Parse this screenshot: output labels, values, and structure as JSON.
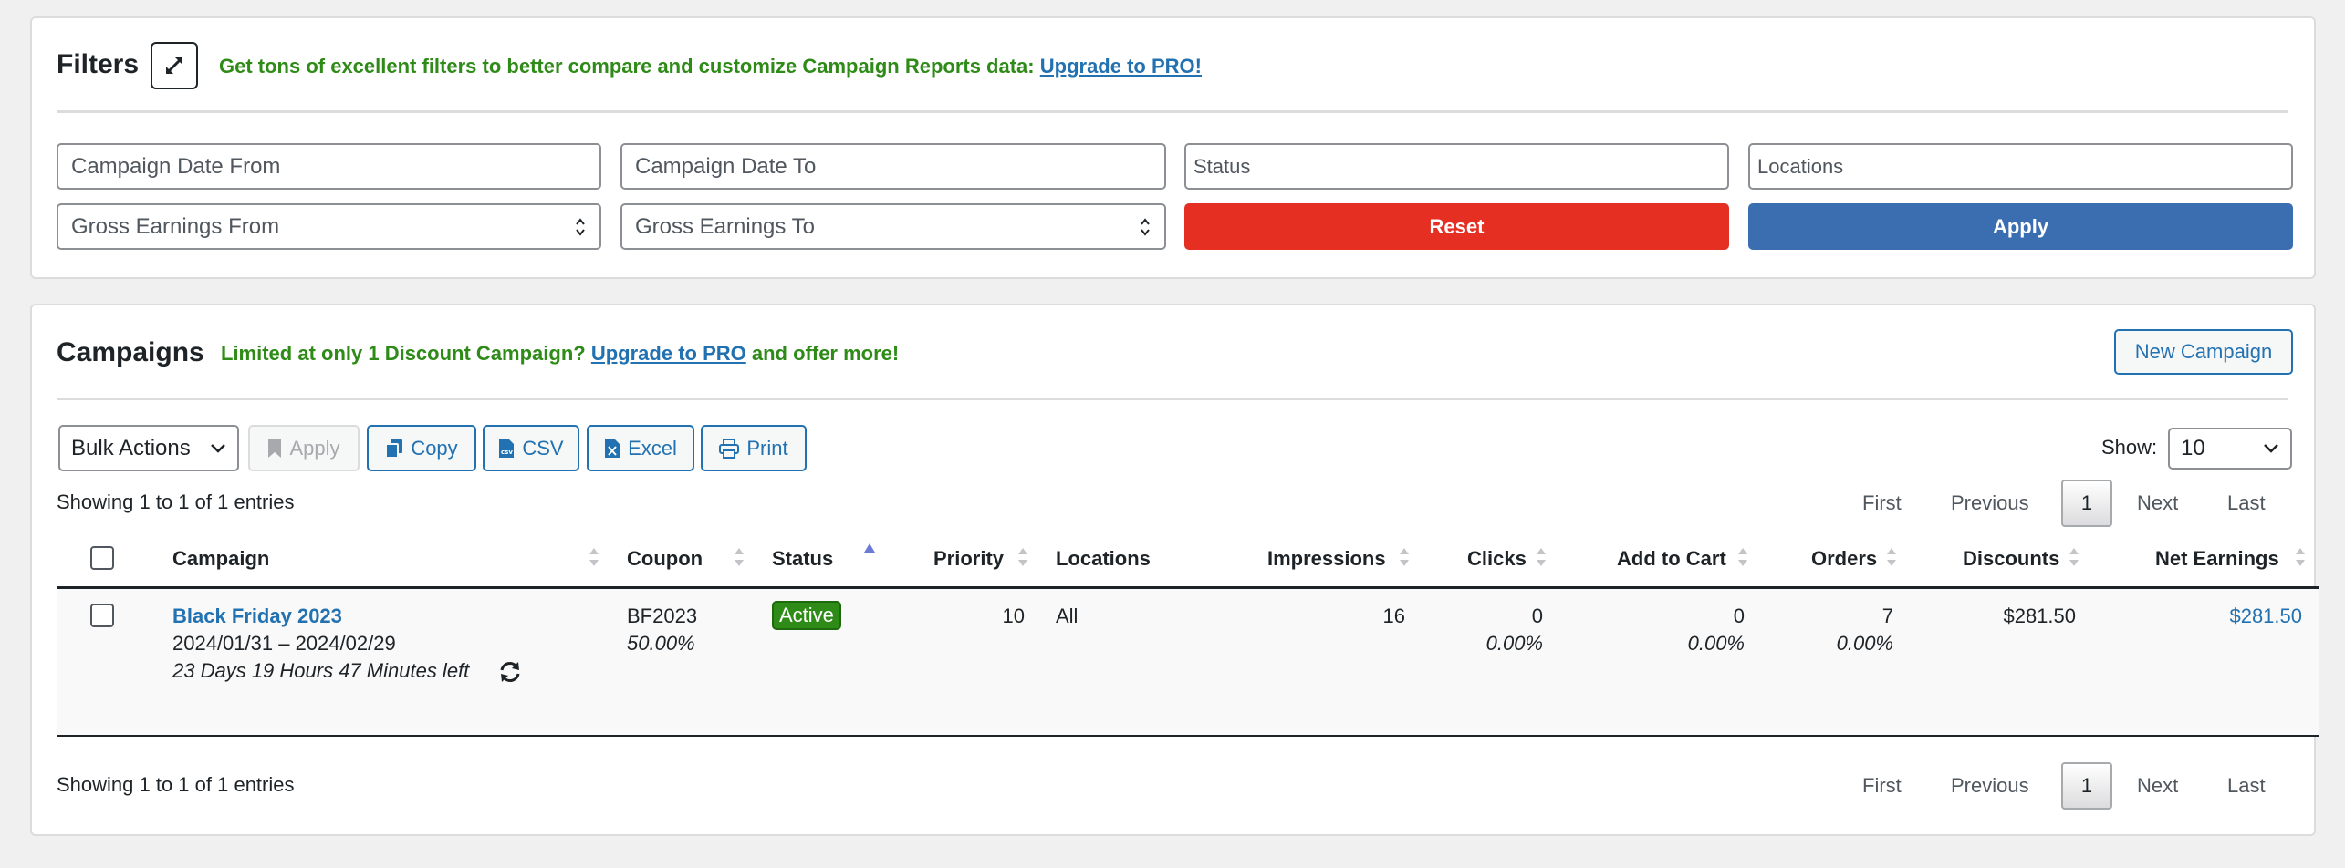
{
  "filters": {
    "title": "Filters",
    "promo_text": "Get tons of excellent filters to better compare and customize Campaign Reports data:",
    "promo_link": "Upgrade to PRO!",
    "date_from": "Campaign Date From",
    "date_to": "Campaign Date To",
    "status": "Status",
    "locations": "Locations",
    "gross_from": "Gross Earnings From",
    "gross_to": "Gross Earnings To",
    "reset_label": "Reset",
    "apply_label": "Apply"
  },
  "campaigns": {
    "title": "Campaigns",
    "promo_prefix": "Limited at only 1 Discount Campaign?",
    "promo_link": "Upgrade to PRO",
    "promo_suffix": "and offer more!",
    "new_campaign_label": "New Campaign",
    "bulk_actions_label": "Bulk Actions",
    "apply_label": "Apply",
    "copy_label": "Copy",
    "csv_label": "CSV",
    "excel_label": "Excel",
    "print_label": "Print",
    "show_label": "Show:",
    "show_value": "10",
    "info_top": "Showing 1 to 1 of 1 entries",
    "info_bottom": "Showing 1 to 1 of 1 entries",
    "pager": {
      "first": "First",
      "previous": "Previous",
      "current": "1",
      "next": "Next",
      "last": "Last"
    },
    "columns": {
      "campaign": "Campaign",
      "coupon": "Coupon",
      "status": "Status",
      "priority": "Priority",
      "locations": "Locations",
      "impressions": "Impressions",
      "clicks": "Clicks",
      "add_to_cart": "Add to Cart",
      "orders": "Orders",
      "discounts": "Discounts",
      "net_earnings": "Net Earnings"
    },
    "rows": [
      {
        "campaign_name": "Black Friday 2023",
        "date_range": "2024/01/31 – 2024/02/29",
        "time_left": "23 Days 19 Hours 47 Minutes left",
        "coupon": "BF2023",
        "coupon_pct": "50.00%",
        "status": "Active",
        "priority": "10",
        "locations": "All",
        "impressions": "16",
        "clicks": "0",
        "clicks_pct": "0.00%",
        "add_to_cart": "0",
        "add_to_cart_pct": "0.00%",
        "orders": "7",
        "orders_pct": "0.00%",
        "discounts": "$281.50",
        "net_earnings": "$281.50"
      }
    ]
  },
  "colors": {
    "accent_blue": "#2271b1",
    "promo_green": "#2e8b17",
    "reset_red": "#e52f22",
    "apply_blue": "#3a6eb0"
  },
  "icons": [
    "expand-icon",
    "spinner-icon",
    "chevron-down-icon",
    "bookmark-icon",
    "copy-icon",
    "csv-file-icon",
    "excel-file-icon",
    "print-icon",
    "sort-icon",
    "sort-ascending-icon",
    "refresh-icon"
  ]
}
